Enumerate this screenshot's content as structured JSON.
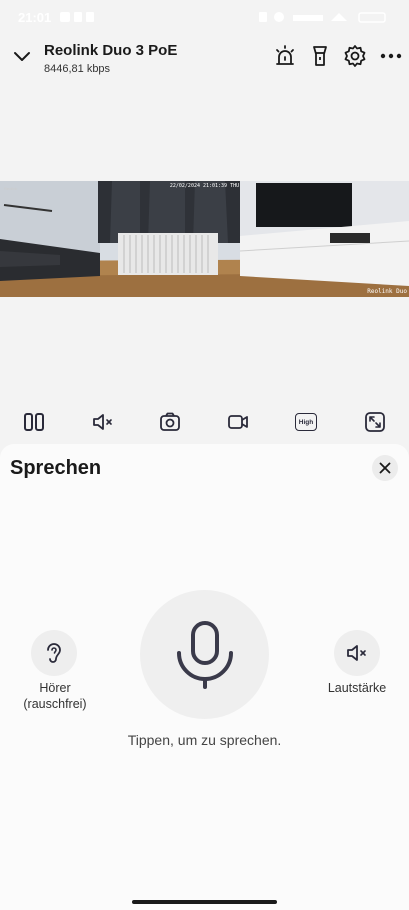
{
  "status_bar": {
    "time": "21:01"
  },
  "header": {
    "title": "Reolink Duo 3 PoE",
    "bitrate": "8446,81 kbps",
    "icons": [
      "chevron-down-icon",
      "siren-icon",
      "spotlight-icon",
      "gear-icon",
      "more-icon"
    ]
  },
  "video": {
    "timestamp": "22/02/2024 21:01:39 THU",
    "camera_label": "Reolink Duo",
    "corner_label": "Reolink"
  },
  "toolbar": {
    "icons": [
      "split-view-icon",
      "speaker-muted-icon",
      "snapshot-icon",
      "record-icon",
      "quality-high-icon",
      "fullscreen-icon"
    ],
    "quality_label": "High"
  },
  "talk_panel": {
    "title": "Sprechen",
    "left_label_line1": "Hörer",
    "left_label_line2": "(rauschfrei)",
    "right_label": "Lautstärke",
    "hint": "Tippen, um zu sprechen."
  },
  "colors": {
    "panel_bg": "#fbfbfb",
    "page_bg": "#f3f3f3",
    "icon_color": "#2a2a3a"
  }
}
